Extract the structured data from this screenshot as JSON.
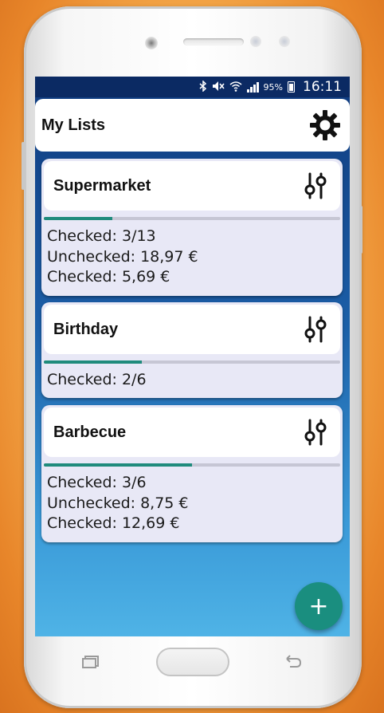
{
  "status_bar": {
    "battery_percent": "95%",
    "time": "16:11",
    "icons": [
      "bluetooth-icon",
      "mute-icon",
      "wifi-icon",
      "signal-icon",
      "battery-charging-icon"
    ]
  },
  "header": {
    "title": "My Lists",
    "settings_icon": "gear-icon"
  },
  "lists": [
    {
      "name": "Supermarket",
      "progress": 0.23,
      "lines": [
        "Checked: 3/13",
        "Unchecked: 18,97 €",
        "Checked: 5,69 €"
      ]
    },
    {
      "name": "Birthday",
      "progress": 0.33,
      "lines": [
        "Checked: 2/6"
      ]
    },
    {
      "name": "Barbecue",
      "progress": 0.5,
      "lines": [
        "Checked: 3/6",
        "Unchecked: 8,75 €",
        "Checked: 12,69 €"
      ]
    }
  ],
  "fab": {
    "label": "+",
    "icon": "add-icon"
  },
  "colors": {
    "accent": "#1a8e7f",
    "status_bar": "#0b2a63",
    "card_body": "#e8e8f6",
    "progress_track": "#c6c6d4"
  }
}
